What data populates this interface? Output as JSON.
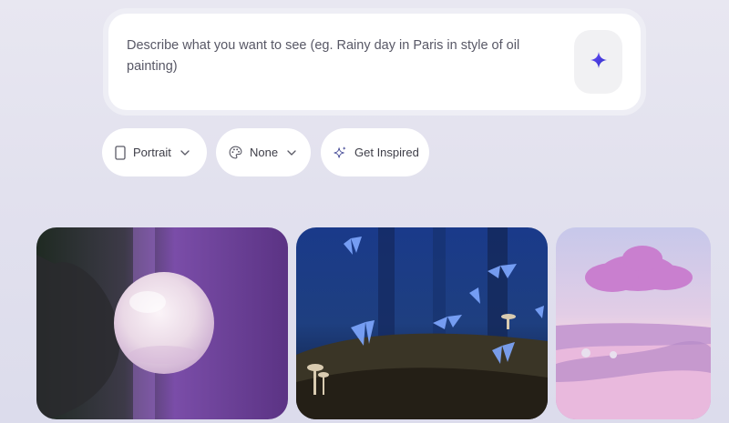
{
  "prompt": {
    "placeholder": "Describe what you want to see (eg. Rainy day in Paris in style of oil painting)"
  },
  "options": {
    "orientation_label": "Portrait",
    "style_label": "None",
    "inspire_label": "Get Inspired"
  },
  "colors": {
    "accent": "#4a3fd6",
    "card_background": "#ffffff",
    "page_background": "#e4e3ef"
  },
  "gallery": [
    {
      "icon": "crystal-ball-photo"
    },
    {
      "icon": "blue-butterflies-forest-photo"
    },
    {
      "icon": "pink-cloud-landscape-photo"
    }
  ]
}
